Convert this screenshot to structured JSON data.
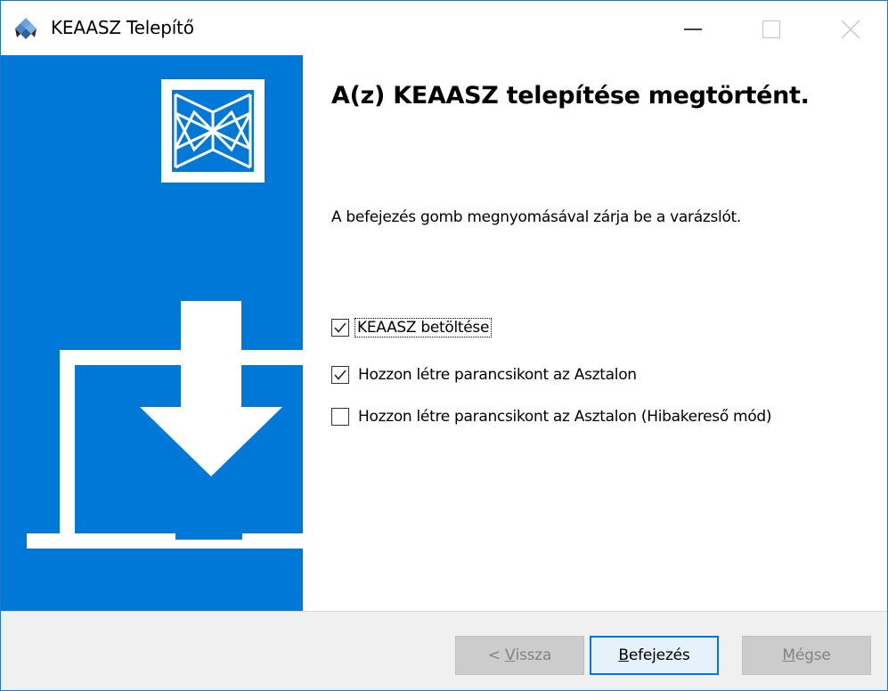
{
  "window": {
    "title": "KEAASZ Telepítő"
  },
  "content": {
    "heading": "A(z) KEAASZ telepítése megtörtént.",
    "description": "A befejezés gomb megnyomásával zárja be a varázslót.",
    "options": [
      {
        "label": "KEAASZ betöltése",
        "checked": true
      },
      {
        "label": "Hozzon létre parancsikont az Asztalon",
        "checked": true
      },
      {
        "label": "Hozzon létre parancsikont az Asztalon (Hibakereső mód)",
        "checked": false
      }
    ]
  },
  "footer": {
    "back_prefix": "< ",
    "back_accel": "V",
    "back_rest": "issza",
    "finish_accel": "B",
    "finish_rest": "efejezés",
    "cancel_accel": "M",
    "cancel_rest": "égse"
  },
  "colors": {
    "accent": "#0078d7",
    "panel": "#0078d7",
    "footer_bg": "#f0f0f0"
  }
}
